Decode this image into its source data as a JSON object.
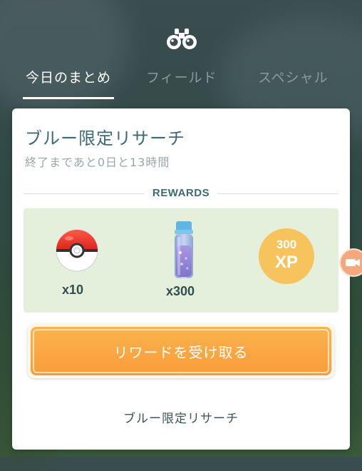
{
  "tabs": [
    {
      "label": "今日のまとめ",
      "active": true
    },
    {
      "label": "フィールド",
      "active": false
    },
    {
      "label": "スペシャル",
      "active": false
    }
  ],
  "header_icon": "binoculars-icon",
  "card": {
    "title": "ブルー限定リサーチ",
    "subtitle": "終了まであと0日と13時間",
    "rewards_heading": "REWARDS",
    "rewards": [
      {
        "icon": "poke-ball-icon",
        "quantity": "x10"
      },
      {
        "icon": "potion-bottle-icon",
        "quantity": "x300"
      },
      {
        "icon": "xp-badge",
        "amount": "300",
        "unit": "XP"
      }
    ],
    "claim_button": "リワードを受け取る",
    "footer_link": "ブルー限定リサーチ"
  },
  "colors": {
    "title": "#3d6a74",
    "rewards_bg": "#e4f0dc",
    "button_orange": "#f89c3b",
    "xp_badge": "#f7c35c"
  }
}
